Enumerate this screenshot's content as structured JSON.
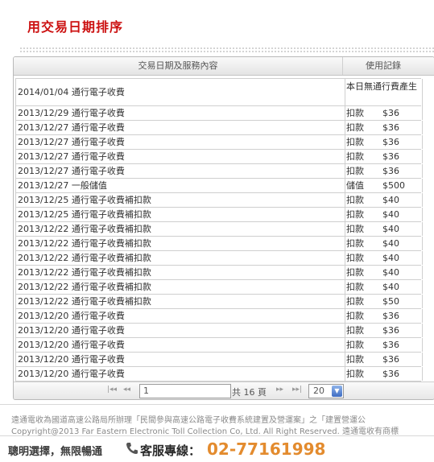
{
  "page": {
    "title": "用交易日期排序"
  },
  "table": {
    "headers": [
      "交易日期及服務內容",
      "使用記錄"
    ],
    "rows": [
      {
        "desc": "2014/01/04 通行電子收費",
        "type": "本日無通行費產生",
        "amount": ""
      },
      {
        "desc": "2013/12/29 通行電子收費",
        "type": "扣款",
        "amount": "$36"
      },
      {
        "desc": "2013/12/27 通行電子收費",
        "type": "扣款",
        "amount": "$36"
      },
      {
        "desc": "2013/12/27 通行電子收費",
        "type": "扣款",
        "amount": "$36"
      },
      {
        "desc": "2013/12/27 通行電子收費",
        "type": "扣款",
        "amount": "$36"
      },
      {
        "desc": "2013/12/27 通行電子收費",
        "type": "扣款",
        "amount": "$36"
      },
      {
        "desc": "2013/12/27 一般儲值",
        "type": "儲值",
        "amount": "$500"
      },
      {
        "desc": "2013/12/25 通行電子收費補扣款",
        "type": "扣款",
        "amount": "$40"
      },
      {
        "desc": "2013/12/25 通行電子收費補扣款",
        "type": "扣款",
        "amount": "$40"
      },
      {
        "desc": "2013/12/22 通行電子收費補扣款",
        "type": "扣款",
        "amount": "$40"
      },
      {
        "desc": "2013/12/22 通行電子收費補扣款",
        "type": "扣款",
        "amount": "$40"
      },
      {
        "desc": "2013/12/22 通行電子收費補扣款",
        "type": "扣款",
        "amount": "$40"
      },
      {
        "desc": "2013/12/22 通行電子收費補扣款",
        "type": "扣款",
        "amount": "$40"
      },
      {
        "desc": "2013/12/22 通行電子收費補扣款",
        "type": "扣款",
        "amount": "$40"
      },
      {
        "desc": "2013/12/22 通行電子收費補扣款",
        "type": "扣款",
        "amount": "$50"
      },
      {
        "desc": "2013/12/20 通行電子收費",
        "type": "扣款",
        "amount": "$36"
      },
      {
        "desc": "2013/12/20 通行電子收費",
        "type": "扣款",
        "amount": "$36"
      },
      {
        "desc": "2013/12/20 通行電子收費",
        "type": "扣款",
        "amount": "$36"
      },
      {
        "desc": "2013/12/20 通行電子收費",
        "type": "扣款",
        "amount": "$36"
      },
      {
        "desc": "2013/12/20 通行電子收費",
        "type": "扣款",
        "amount": "$36"
      }
    ]
  },
  "pager": {
    "first": "|◂◂",
    "prev": "◂◂",
    "current_page": "1",
    "total_label": "共 16 頁",
    "next": "▸▸",
    "last": "▸▸|",
    "page_size": "20"
  },
  "footer": {
    "line1": "遠通電收為國道高速公路局所辦理「民間參與高速公路電子收費系統建置及營運案」之「建置營運公",
    "line2": "Copyright@2013 Far Eastern Electronic Toll Collection Co, Ltd. All Right Reserved. 遠通電收有商標",
    "slogan": "聰明選擇，無限暢通",
    "hotline_label": "客服專線：",
    "hotline_number": "02-77161998"
  },
  "colors": {
    "title_red": "#cc1111",
    "hotline_orange": "#e38b2e",
    "select_arrow_blue": "#3f6cc2"
  }
}
